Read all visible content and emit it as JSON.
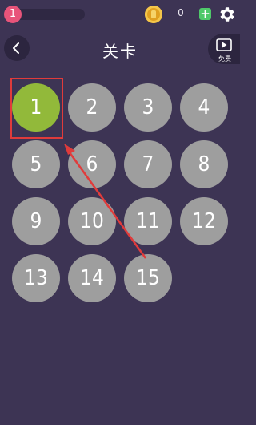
{
  "topbar": {
    "level_badge": "1",
    "coins": "0",
    "icons": [
      "coin-icon",
      "plus-icon",
      "gear-icon"
    ]
  },
  "header": {
    "title": "关卡",
    "video_label": "免费",
    "icons": [
      "back-arrow-icon",
      "video-play-icon"
    ]
  },
  "levels": [
    "1",
    "2",
    "3",
    "4",
    "5",
    "6",
    "7",
    "8",
    "9",
    "10",
    "11",
    "12",
    "13",
    "14",
    "15"
  ],
  "current_level": "1",
  "colors": {
    "background": "#3d3454",
    "level_locked": "#9e9e9e",
    "level_current": "#92b93a",
    "badge": "#e8547a",
    "coin": "#e0a021",
    "plus": "#4fc96a",
    "annotation": "#e03b3b"
  }
}
